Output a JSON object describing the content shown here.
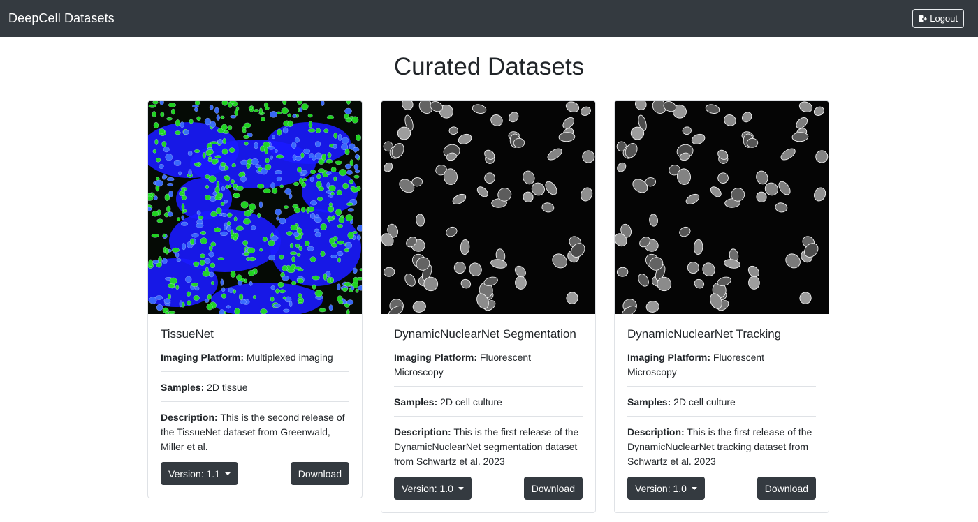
{
  "navbar": {
    "brand": "DeepCell Datasets",
    "logout_label": "Logout",
    "logout_icon": "sign-out-icon"
  },
  "page": {
    "title": "Curated Datasets"
  },
  "cards": [
    {
      "title": "TissueNet",
      "platform_label": "Imaging Platform:",
      "platform": "Multiplexed imaging",
      "samples_label": "Samples:",
      "samples": "2D tissue",
      "description_label": "Description:",
      "description": "This is the second release of the TissueNet dataset from Greenwald, Miller et al.",
      "version_label": "Version: 1.1",
      "download_label": "Download"
    },
    {
      "title": "DynamicNuclearNet Segmentation",
      "platform_label": "Imaging Platform:",
      "platform": "Fluorescent Microscopy",
      "samples_label": "Samples:",
      "samples": "2D cell culture",
      "description_label": "Description:",
      "description": "This is the first release of the DynamicNuclearNet segmentation dataset from Schwartz et al. 2023",
      "version_label": "Version: 1.0",
      "download_label": "Download"
    },
    {
      "title": "DynamicNuclearNet Tracking",
      "platform_label": "Imaging Platform:",
      "platform": "Fluorescent Microscopy",
      "samples_label": "Samples:",
      "samples": "2D cell culture",
      "description_label": "Description:",
      "description": "This is the first release of the DynamicNuclearNet tracking dataset from Schwartz et al. 2023",
      "version_label": "Version: 1.0",
      "download_label": "Download"
    }
  ],
  "colors": {
    "navbar_bg": "#343a40",
    "button_bg": "#343a40",
    "tissue_blue": "#1a1aff",
    "tissue_green": "#22dd22"
  }
}
